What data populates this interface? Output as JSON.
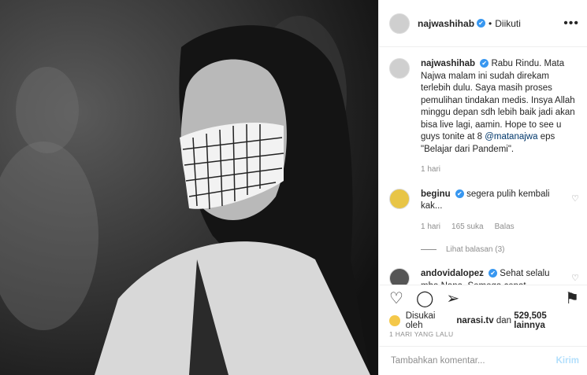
{
  "post_header": {
    "username": "najwashihab",
    "verified": "✔",
    "separator": "•",
    "follow_status": "Diikuti",
    "more": "•••"
  },
  "caption": {
    "username": "najwashihab",
    "text_before": "Rabu Rindu. Mata Najwa malam ini sudah direkam terlebih dulu. Saya masih proses pemulihan tindakan medis. Insya Allah minggu depan sdh lebih baik jadi akan bisa live lagi, aamin. Hope to see u guys tonite at 8 ",
    "mention": "@matanajwa",
    "text_after": " eps \"Belajar dari Pandemi\".",
    "time": "1 hari"
  },
  "comments": [
    {
      "username": "beginu",
      "text": "segera pulih kembali kak...",
      "time": "1 hari",
      "likes": "165 suka",
      "reply": "Balas",
      "view_replies": "Lihat balasan (3)"
    },
    {
      "username": "andovidalopez",
      "text": "Sehat selalu mba Nana. Semoga cepat"
    }
  ],
  "likes": {
    "prefix": "Disukai oleh",
    "user": "narasi.tv",
    "middle": "dan",
    "count": "529,505 lainnya"
  },
  "date": "1 HARI YANG LALU",
  "add_comment": {
    "placeholder": "Tambahkan komentar...",
    "post": "Kirim"
  },
  "icons": [
    "heart-icon",
    "comment-icon",
    "share-icon",
    "bookmark-icon"
  ]
}
